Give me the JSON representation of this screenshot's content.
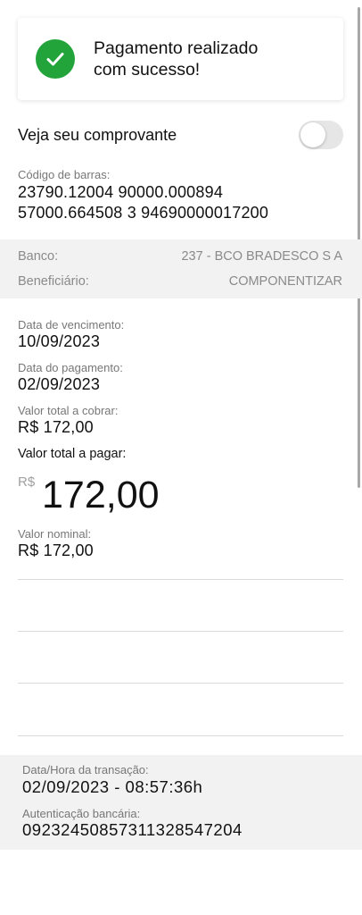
{
  "success": {
    "message_line1": "Pagamento realizado",
    "message_line2": "com sucesso!",
    "icon": "check-icon",
    "accent_color": "#22a43a"
  },
  "receipt_toggle": {
    "label": "Veja seu comprovante",
    "checked": false
  },
  "barcode": {
    "label": "Código de barras:",
    "line1": "23790.12004 90000.000894",
    "line2": "57000.664508 3 94690000017200"
  },
  "bank_info": {
    "bank_label": "Banco:",
    "bank_value": "237 - BCO BRADESCO S A",
    "beneficiary_label": "Beneficiário:",
    "beneficiary_value": "COMPONENTIZAR"
  },
  "details": {
    "due_date_label": "Data de vencimento:",
    "due_date_value": "10/09/2023",
    "payment_date_label": "Data do pagamento:",
    "payment_date_value": "02/09/2023",
    "total_charge_label": "Valor total a cobrar:",
    "total_charge_value": "R$  172,00",
    "total_pay_label": "Valor total a pagar:",
    "total_pay_currency": "R$",
    "total_pay_amount": "172,00",
    "nominal_label": "Valor nominal:",
    "nominal_value": "R$  172,00"
  },
  "transaction": {
    "datetime_label": "Data/Hora da transação:",
    "datetime_value": "02/09/2023 - 08:57:36h",
    "auth_label": "Autenticação bancária:",
    "auth_value": "09232450857311328547204"
  }
}
